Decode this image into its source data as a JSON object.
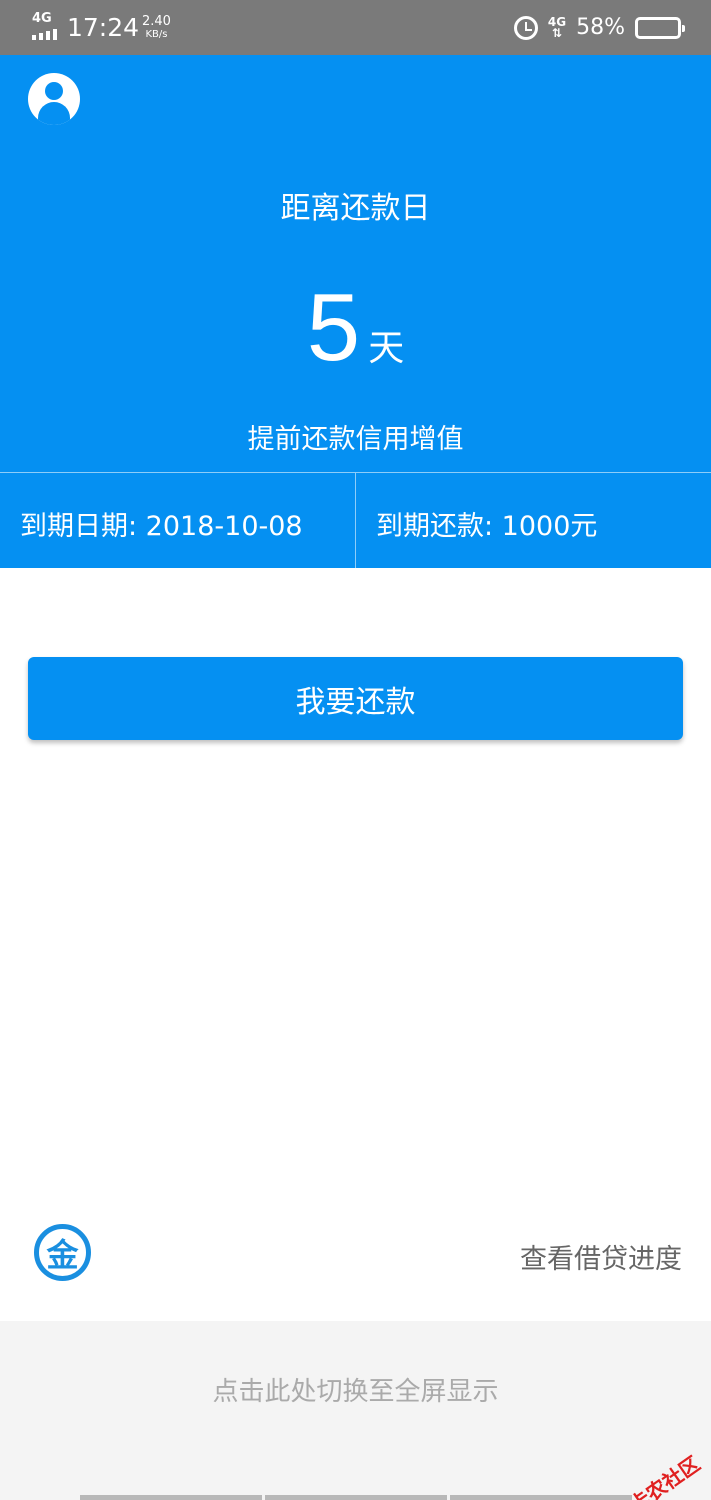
{
  "status_bar": {
    "network": "4G",
    "time": "17:24",
    "speed_value": "2.40",
    "speed_unit": "KB/s",
    "network_right": "4G",
    "battery": "58%",
    "battery_level": 0.58
  },
  "hero": {
    "title": "距离还款日",
    "days": "5",
    "days_unit": "天",
    "subtitle": "提前还款信用增值",
    "due_date": "到期日期: 2018-10-08",
    "due_amount": "到期还款: 1000元"
  },
  "actions": {
    "repay_label": "我要还款"
  },
  "footer": {
    "logo_char": "金",
    "progress_link": "查看借贷进度",
    "fullscreen": "点击此处切换至全屏显示"
  },
  "watermark": {
    "text": "卡农社区"
  },
  "colors": {
    "primary": "#0590f2",
    "status_bar": "#7a7a7a"
  }
}
